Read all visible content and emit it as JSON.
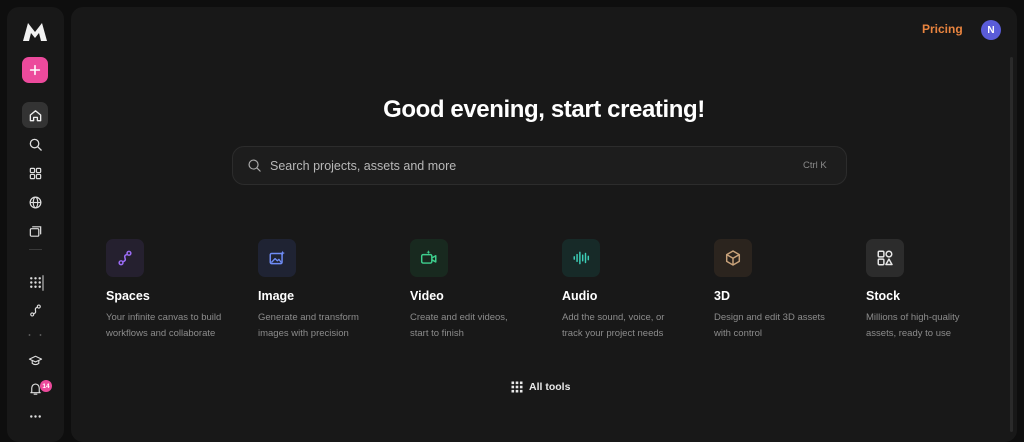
{
  "sidebar": {
    "logo": "m-logo-icon",
    "items": [
      {
        "icon": "plus-icon",
        "name": "new-button"
      },
      {
        "icon": "home-icon",
        "name": "sidebar-item-home",
        "active": true
      },
      {
        "icon": "search-icon",
        "name": "sidebar-item-search"
      },
      {
        "icon": "apps-grid-icon",
        "name": "sidebar-item-apps"
      },
      {
        "icon": "globe-icon",
        "name": "sidebar-item-community"
      },
      {
        "icon": "library-icon",
        "name": "sidebar-item-library"
      },
      {
        "icon": "grid-dots-icon",
        "name": "sidebar-item-tools"
      },
      {
        "icon": "spaces-icon",
        "name": "sidebar-item-spaces"
      },
      {
        "icon": "graduation-cap-icon",
        "name": "sidebar-item-learn"
      },
      {
        "icon": "bell-icon",
        "name": "sidebar-item-notifications"
      },
      {
        "icon": "more-icon",
        "name": "sidebar-item-more"
      }
    ],
    "notification_count": "14"
  },
  "header": {
    "pricing_label": "Pricing",
    "avatar_initial": "N"
  },
  "main": {
    "headline": "Good evening, start creating!",
    "search": {
      "placeholder": "Search projects, assets and more",
      "shortcut": "Ctrl K"
    },
    "cards": [
      {
        "title": "Spaces",
        "description": "Your infinite canvas to build workflows and collaborate",
        "icon": "spaces-icon",
        "color": "#9b6cf5",
        "bg": "#25202f"
      },
      {
        "title": "Image",
        "description": "Generate and transform images with precision",
        "icon": "image-sparkle-icon",
        "color": "#6f8cf5",
        "bg": "#1f2333"
      },
      {
        "title": "Video",
        "description": "Create and edit videos, start to finish",
        "icon": "video-sparkle-icon",
        "color": "#3ecf8e",
        "bg": "#18291f"
      },
      {
        "title": "Audio",
        "description": "Add the sound, voice, or track your project needs",
        "icon": "waveform-icon",
        "color": "#3ccfb8",
        "bg": "#172a28"
      },
      {
        "title": "3D",
        "description": "Design and edit 3D assets with control",
        "icon": "cube-icon",
        "color": "#c8a27a",
        "bg": "#2b241e"
      },
      {
        "title": "Stock",
        "description": "Millions of high-quality assets, ready to use",
        "icon": "shapes-icon",
        "color": "#e8e8e8",
        "bg": "#2c2c2c"
      }
    ],
    "all_tools_label": "All tools"
  },
  "colors": {
    "accent_pink": "#ec4a9c",
    "pricing_orange": "#e9843f",
    "avatar_purple": "#5a5cd8"
  }
}
